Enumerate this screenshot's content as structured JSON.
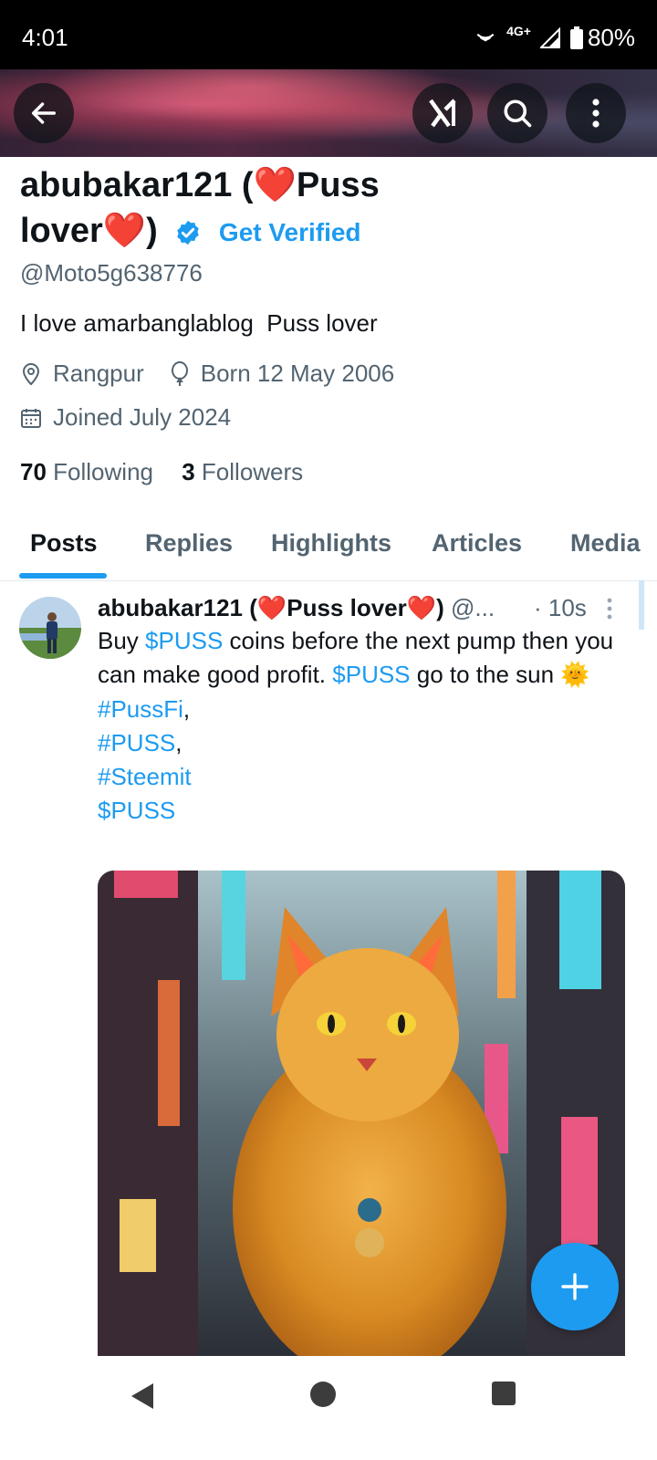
{
  "status_bar": {
    "time": "4:01",
    "network": "4G+",
    "battery": "80%"
  },
  "header": {
    "back_icon": "back-arrow-icon",
    "grok_icon": "grok-icon",
    "search_icon": "search-icon",
    "more_icon": "more-vertical-icon"
  },
  "profile": {
    "name": "abubakar121 (❤️Puss lover❤️)",
    "name_line1": "abubakar121 (❤️Puss",
    "name_line2": "lover❤️)",
    "get_verified": "Get Verified",
    "handle": "@Moto5g638776",
    "bio": "I love amarbanglablog  Puss lover",
    "location": "Rangpur",
    "birthday": "Born 12 May 2006",
    "joined": "Joined July 2024",
    "following_count": "70",
    "following_label": "Following",
    "followers_count": "3",
    "followers_label": "Followers"
  },
  "tabs": [
    {
      "label": "Posts",
      "active": true
    },
    {
      "label": "Replies"
    },
    {
      "label": "Highlights"
    },
    {
      "label": "Articles"
    },
    {
      "label": "Media"
    }
  ],
  "post": {
    "author": "abubakar121 (❤️Puss lover❤️)",
    "handle_truncated": "@...",
    "time": "· 10s",
    "text_parts": {
      "t1": "Buy ",
      "cashtag1": "$PUSS",
      "t2": " coins before the next pump then you can make good profit. ",
      "cashtag2": "$PUSS",
      "t3": " go to the sun 🌞",
      "hashtag1": "#PussFi",
      "comma1": ",",
      "hashtag2": "#PUSS",
      "comma2": ",",
      "hashtag3": "#Steemit",
      "cashtag3": "$PUSS"
    }
  },
  "fab_icon": "plus-icon",
  "nav": {
    "back": "nav-back-icon",
    "home": "nav-home-icon",
    "recents": "nav-recents-icon"
  },
  "colors": {
    "accent": "#1d9bf0",
    "text": "#0f1419",
    "secondary": "#536471"
  }
}
